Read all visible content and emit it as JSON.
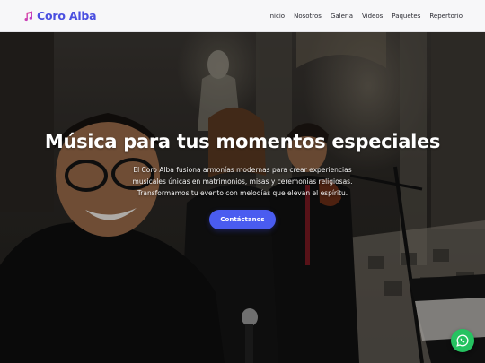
{
  "brand": {
    "name": "Coro Alba",
    "icon": "music-note-icon",
    "color": "#4a4fe0"
  },
  "nav": {
    "items": [
      "Inicio",
      "Nosotros",
      "Galeria",
      "Videos",
      "Paquetes",
      "Repertorio"
    ]
  },
  "hero": {
    "title": "Música para tus momentos especiales",
    "subtitle": "El Coro Alba fusiona armonías modernas para crear experiencias musicales únicas en matrimonios, misas y ceremonias religiosas. Transformamos tu evento con melodías que elevan el espíritu.",
    "cta_label": "Contáctanos",
    "cta_color": "#4a5cf0"
  },
  "floating": {
    "icon": "whatsapp-icon",
    "color": "#25c260"
  }
}
